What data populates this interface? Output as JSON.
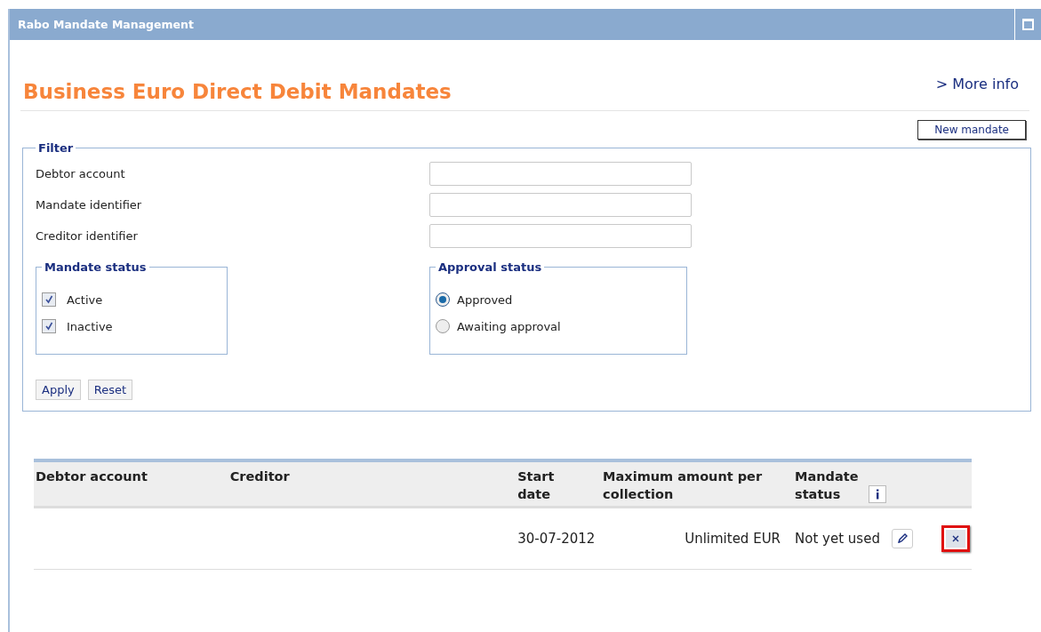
{
  "window": {
    "title": "Rabo Mandate Management"
  },
  "heading": "Business Euro Direct Debit Mandates",
  "more_info_link": "> More info",
  "new_mandate_button": "New mandate",
  "filter": {
    "legend": "Filter",
    "fields": [
      {
        "label": "Debtor account"
      },
      {
        "label": "Mandate identifier"
      },
      {
        "label": "Creditor identifier"
      }
    ],
    "mandate_status": {
      "legend": "Mandate status",
      "options": [
        {
          "label": "Active",
          "checked": true
        },
        {
          "label": "Inactive",
          "checked": true
        }
      ]
    },
    "approval_status": {
      "legend": "Approval status",
      "options": [
        {
          "label": "Approved",
          "selected": true
        },
        {
          "label": "Awaiting approval",
          "selected": false
        }
      ]
    },
    "buttons": [
      "Apply",
      "Reset"
    ]
  },
  "table": {
    "columns": [
      "Debtor account",
      "Creditor",
      "Start date",
      "Maximum amount per collection",
      "Mandate status"
    ],
    "rows": [
      {
        "start_date": "30-07-2012",
        "max_amount": "Unlimited EUR",
        "status": "Not yet used",
        "delete_highlighted": true
      }
    ]
  }
}
